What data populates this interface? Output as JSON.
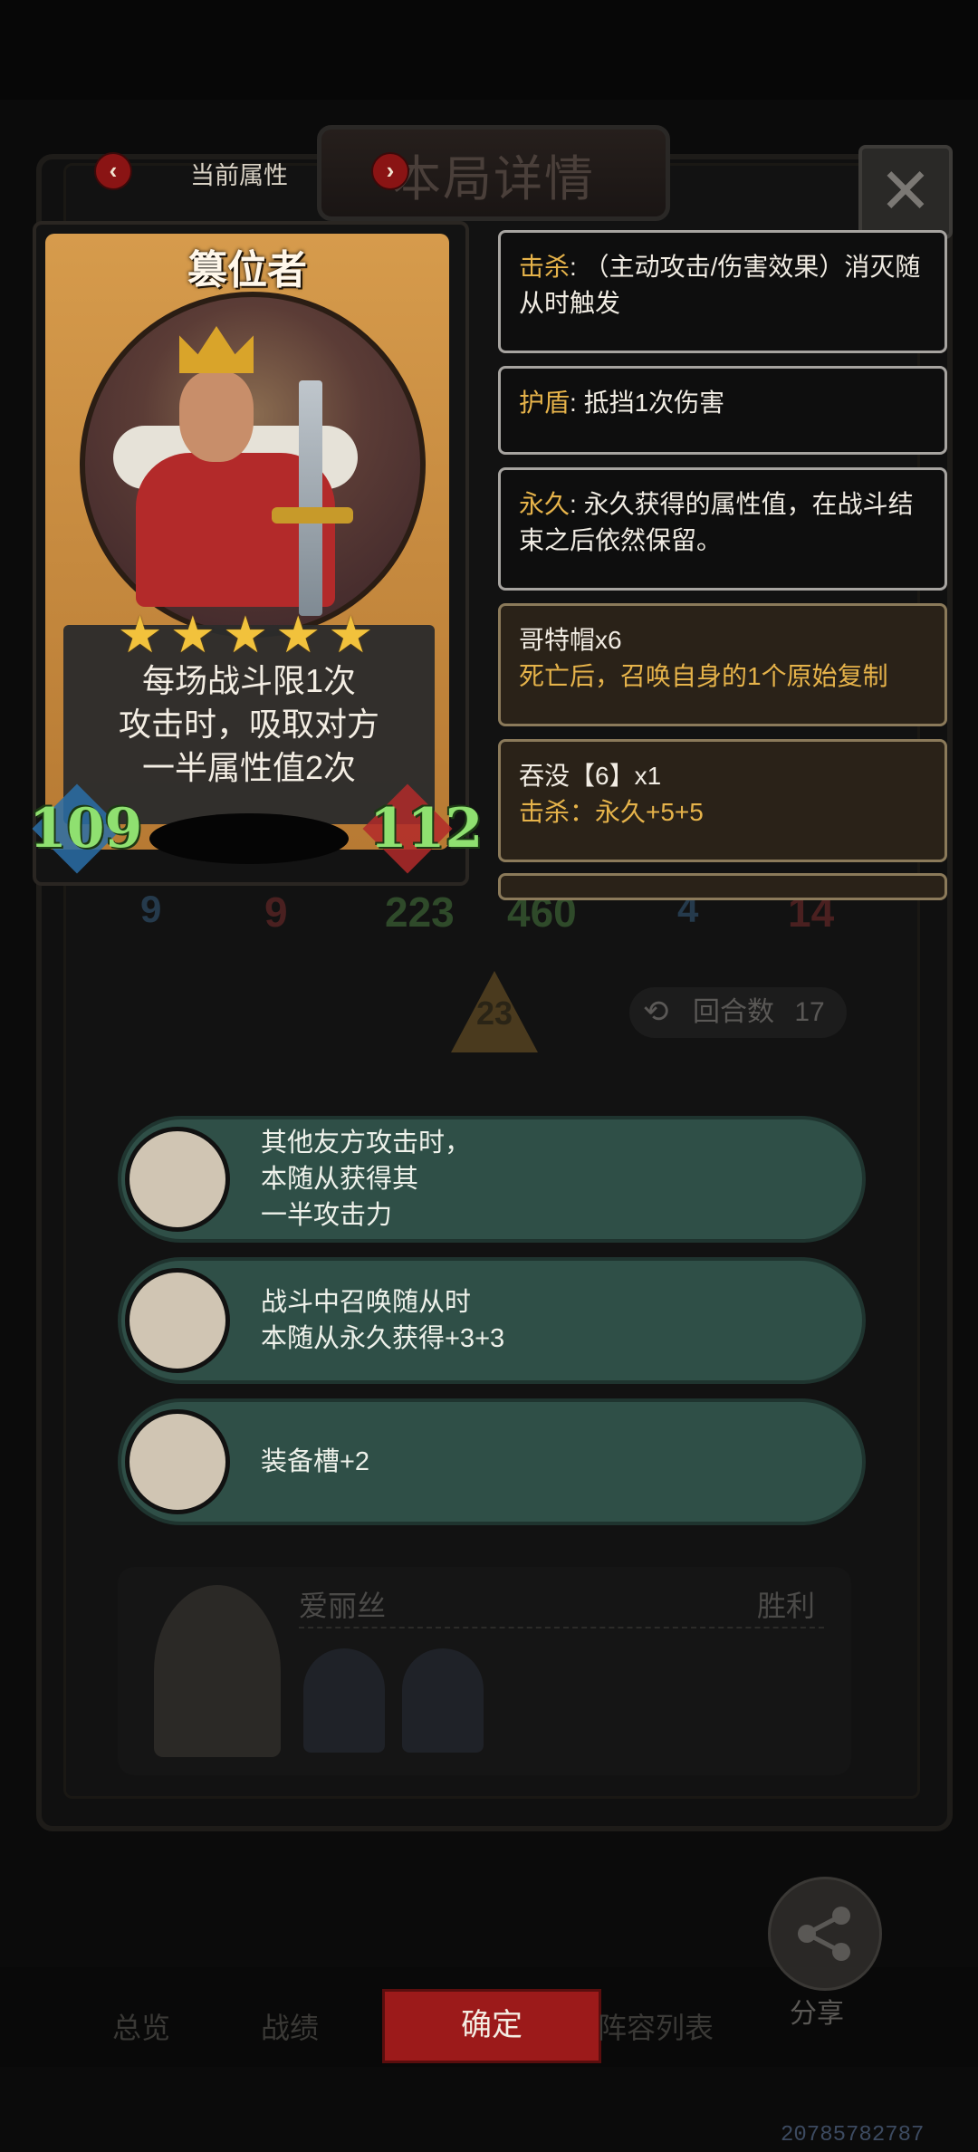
{
  "header": {
    "current_attr_label": "当前属性",
    "title": "本局详情",
    "close_glyph": "✕",
    "left_arrow": "‹",
    "right_arrow": "›"
  },
  "card": {
    "name": "篡位者",
    "stars": "★★★★★",
    "star_count": 5,
    "ability_line1": "每场战斗限1次",
    "ability_line2": "攻击时，吸取对方",
    "ability_line3": "一半属性值2次",
    "attack": "109",
    "health": "112"
  },
  "keywords": [
    {
      "key": "击杀",
      "text": ": （主动攻击/伤害效果）消灭随从时触发"
    },
    {
      "key": "护盾",
      "text": ": 抵挡1次伤害"
    },
    {
      "key": "永久",
      "text": ": 永久获得的属性值，在战斗结束之后依然保留。"
    }
  ],
  "effects": [
    {
      "title": "哥特帽x6",
      "desc": "死亡后，召唤自身的1个原始复制"
    },
    {
      "title": "吞没【6】x1",
      "desc": "击杀：永久+5+5"
    }
  ],
  "background": {
    "stat_a1": "9",
    "stat_a2": "9",
    "stat_b1": "223",
    "stat_b2": "460",
    "stat_c1": "4",
    "stat_c2": "14",
    "level": "23",
    "round_label": "回合数",
    "round_value": "17"
  },
  "traits": [
    {
      "icon": "staff-icon",
      "lines": [
        "其他友方攻击时，",
        "本随从获得其",
        "一半攻击力"
      ]
    },
    {
      "icon": "spider-icon",
      "lines": [
        "战斗中召唤随从时",
        "本随从永久获得+3+3"
      ]
    },
    {
      "icon": "pig-icon",
      "lines": [
        "装备槽+2"
      ]
    }
  ],
  "record": {
    "name": "爱丽丝",
    "result": "胜利"
  },
  "bottom": {
    "tab1": "总览",
    "tab2": "战绩",
    "confirm": "确定",
    "tab4": "阵容列表",
    "share": "分享"
  },
  "footer_id": "20785782787",
  "colors": {
    "keyword_accent": "#e6b34a",
    "confirm_red": "#9c1a1a",
    "trait_green": "#2f4f47",
    "stat_green": "#8fe070"
  }
}
